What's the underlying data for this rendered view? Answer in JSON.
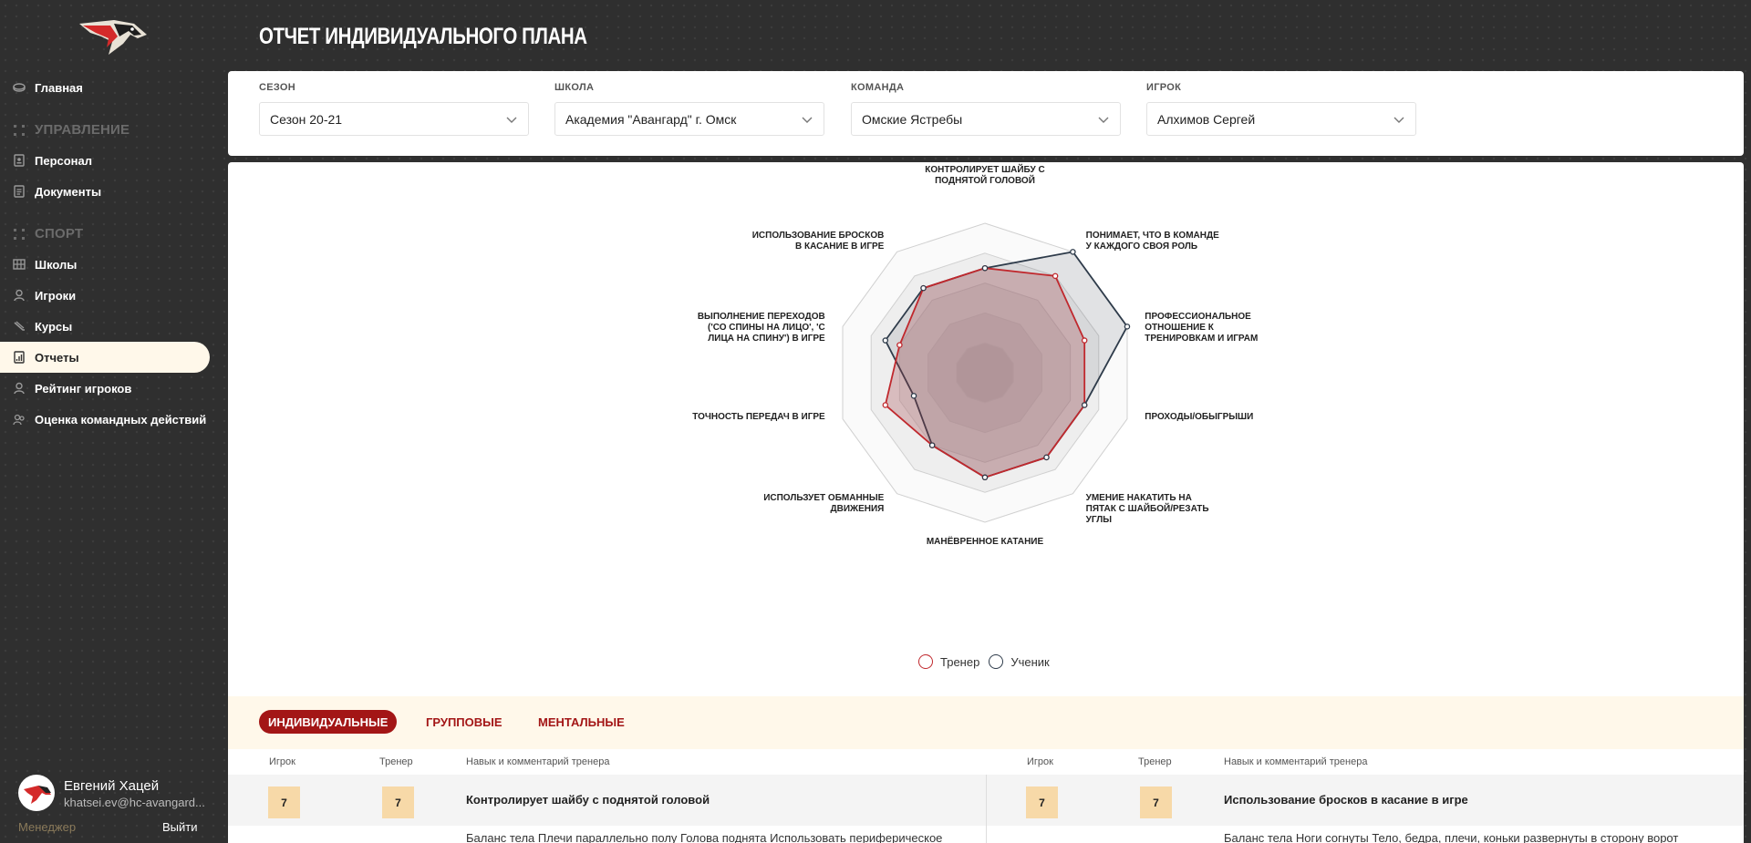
{
  "sidebar": {
    "items": [
      {
        "label": "Главная",
        "icon": "disc-icon"
      },
      {
        "label": "Персонал",
        "icon": "badge-icon"
      },
      {
        "label": "Документы",
        "icon": "document-icon"
      },
      {
        "label": "Школы",
        "icon": "building-icon"
      },
      {
        "label": "Игроки",
        "icon": "player-icon"
      },
      {
        "label": "Курсы",
        "icon": "stick-icon"
      },
      {
        "label": "Отчеты",
        "icon": "report-icon"
      },
      {
        "label": "Рейтинг игроков",
        "icon": "rating-icon"
      },
      {
        "label": "Оценка командных действий",
        "icon": "team-icon"
      }
    ],
    "sections": [
      "УПРАВЛЕНИЕ",
      "СПОРТ"
    ]
  },
  "user": {
    "name": "Евгений Хацей",
    "email": "khatsei.ev@hc-avangard...",
    "role": "Менеджер",
    "logout": "Выйти"
  },
  "page": {
    "title": "ОТЧЕТ ИНДИВИДУАЛЬНОГО ПЛАНА"
  },
  "filters": [
    {
      "label": "СЕЗОН",
      "value": "Сезон 20-21"
    },
    {
      "label": "ШКОЛА",
      "value": "Академия \"Авангард\" г. Омск"
    },
    {
      "label": "КОМАНДА",
      "value": "Омские Ястребы"
    },
    {
      "label": "ИГРОК",
      "value": "Алхимов Сергей"
    }
  ],
  "chart_data": {
    "type": "radar",
    "scale_max": 10,
    "axes": [
      "КОНТРОЛИРУЕТ ШАЙБУ С ПОДНЯТОЙ ГОЛОВОЙ",
      "ПОНИМАЕТ, ЧТО В КОМАНДЕ У КАЖДОГО СВОЯ РОЛЬ",
      "ПРОФЕССИОНАЛЬНОЕ ОТНОШЕНИЕ К ТРЕНИРОВКАМ И ИГРАМ",
      "ПРОХОДЫ/ОБЫГРЫШИ",
      "УМЕНИЕ НАКАТИТЬ НА ПЯТАК С ШАЙБОЙ/РЕЗАТЬ УГЛЫ",
      "МАНЁВРЕННОЕ КАТАНИЕ",
      "ИСПОЛЬЗУЕТ ОБМАННЫЕ ДВИЖЕНИЯ",
      "ТОЧНОСТЬ ПЕРЕДАЧ В ИГРЕ",
      "ВЫПОЛНЕНИЕ ПЕРЕХОДОВ ('СО СПИНЫ НА ЛИЦО', 'С ЛИЦА НА СПИНУ') В ИГРЕ",
      "ИСПОЛЬЗОВАНИЕ БРОСКОВ В КАСАНИЕ В ИГРЕ"
    ],
    "series": [
      {
        "name": "Тренер",
        "color": "#c0282d",
        "values": [
          7,
          8,
          7,
          7,
          7,
          7,
          6,
          7,
          6,
          7
        ]
      },
      {
        "name": "Ученик",
        "color": "#2e3b4a",
        "values": [
          7,
          10,
          10,
          7,
          7,
          7,
          6,
          5,
          7,
          7
        ]
      }
    ]
  },
  "tabs": [
    {
      "label": "ИНДИВИДУАЛЬНЫЕ",
      "active": true
    },
    {
      "label": "ГРУППОВЫЕ",
      "active": false
    },
    {
      "label": "МЕНТАЛЬНЫЕ",
      "active": false
    }
  ],
  "table": {
    "columns": [
      "Игрок",
      "Тренер",
      "Навык и комментарий тренера"
    ],
    "rows": [
      {
        "player": "7",
        "coach": "7",
        "skill": "Контролирует шайбу с поднятой головой",
        "comment": "Баланс тела Плечи параллельно полу Голова поднята Использовать периферическое"
      },
      {
        "player": "7",
        "coach": "7",
        "skill": "Использование бросков в касание в игре",
        "comment": "Баланс тела Ноги согнуты Тело, бедра, плечи, коньки развернуты в сторону ворот"
      }
    ]
  }
}
